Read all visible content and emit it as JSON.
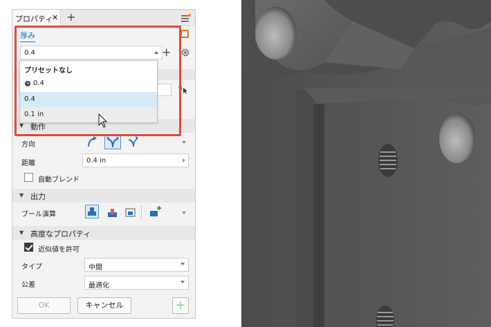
{
  "panel": {
    "tab_title": "プロパティ",
    "close_glyph": "✕",
    "add_tab_glyph": "+",
    "thickness_label": "厚み",
    "thickness_value": "0.4",
    "add_glyph": "+"
  },
  "dropdown": {
    "header": "プリセットなし",
    "recent": "0.4",
    "items": [
      "0.4",
      "0.1 in"
    ]
  },
  "behavior": {
    "section": "動作",
    "direction_label": "方向",
    "distance_label": "距離",
    "distance_value": "0.4 in",
    "auto_blend_label": "自動ブレンド"
  },
  "output": {
    "section": "出力",
    "boolean_label": "ブール演算"
  },
  "advanced": {
    "section": "高度なプロパティ",
    "allow_approx_label": "近似値を許可",
    "type_label": "タイプ",
    "type_value": "中間",
    "tolerance_label": "公差",
    "tolerance_value": "最適化"
  },
  "footer": {
    "ok": "OK",
    "cancel": "キャンセル",
    "plus_glyph": "+"
  },
  "colors": {
    "highlight": "#e8473a",
    "accent_blue": "#1a73c8",
    "notify": "#f28a30"
  }
}
